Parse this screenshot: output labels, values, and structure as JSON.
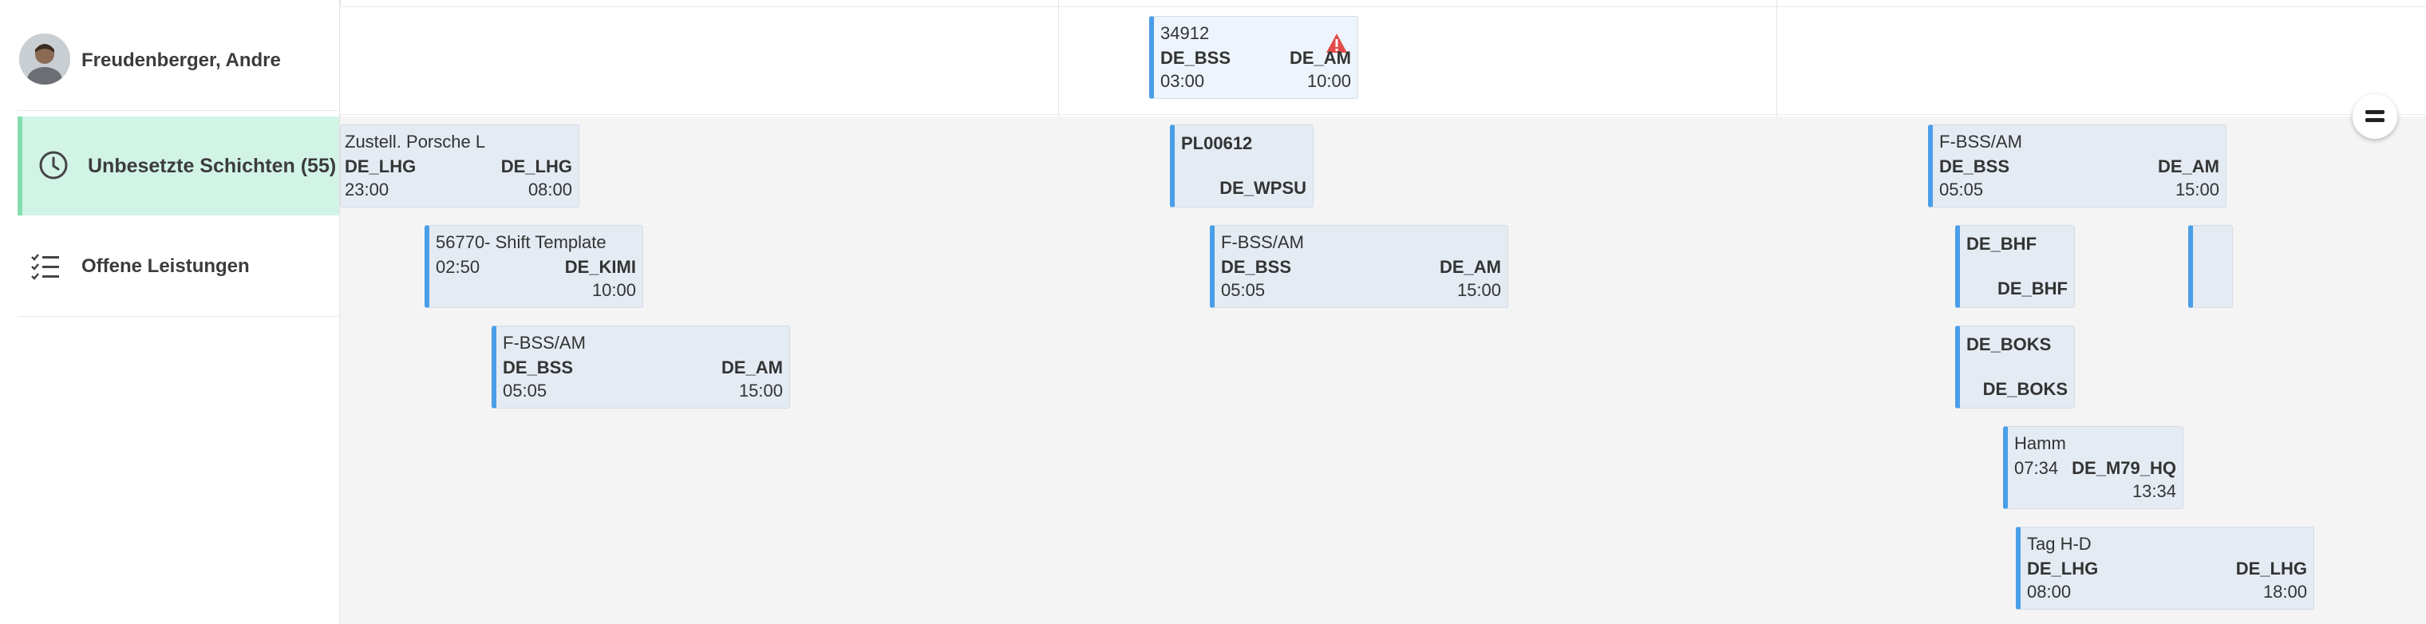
{
  "person": {
    "name": "Freudenberger, Andre"
  },
  "sidebar": {
    "unassigned_label": "Unbesetzte Schichten (55)",
    "open_services_label": "Offene Leistungen"
  },
  "shifts": {
    "person_shift": {
      "id": "34912",
      "from_code": "DE_BSS",
      "to_code": "DE_AM",
      "start": "03:00",
      "end": "10:00"
    },
    "c1": {
      "title": "Zustell. Porsche L",
      "from_code": "DE_LHG",
      "to_code": "DE_LHG",
      "start": "23:00",
      "end": "08:00"
    },
    "c2": {
      "title": "56770- Shift Template",
      "start": "02:50",
      "code": "DE_KIMI",
      "end": "10:00"
    },
    "c3": {
      "title": "F-BSS/AM",
      "from_code": "DE_BSS",
      "to_code": "DE_AM",
      "start": "05:05",
      "end": "15:00"
    },
    "c4": {
      "title": "PL00612",
      "code": "DE_WPSU"
    },
    "c5": {
      "title": "F-BSS/AM",
      "from_code": "DE_BSS",
      "to_code": "DE_AM",
      "start": "05:05",
      "end": "15:00"
    },
    "c6": {
      "title": "F-BSS/AM",
      "from_code": "DE_BSS",
      "to_code": "DE_AM",
      "start": "05:05",
      "end": "15:00"
    },
    "c7": {
      "title": "DE_BHF",
      "code": "DE_BHF"
    },
    "c8": {
      "title": "DE_BOKS",
      "code": "DE_BOKS"
    },
    "c9": {
      "title": "Hamm",
      "start": "07:34",
      "code": "DE_M79_HQ",
      "end": "13:34"
    },
    "c10": {
      "title": "Tag H-D",
      "from_code": "DE_LHG",
      "to_code": "DE_LHG",
      "start": "08:00",
      "end": "18:00"
    }
  },
  "colors": {
    "accent": "#4a9ee8",
    "unassigned_bg": "#d2f4e6",
    "unassigned_border": "#84dcae",
    "warning": "#e34b4b"
  },
  "icons": [
    "person-avatar",
    "clock-icon",
    "checklist-icon",
    "warning-icon",
    "menu-toggle-icon"
  ]
}
